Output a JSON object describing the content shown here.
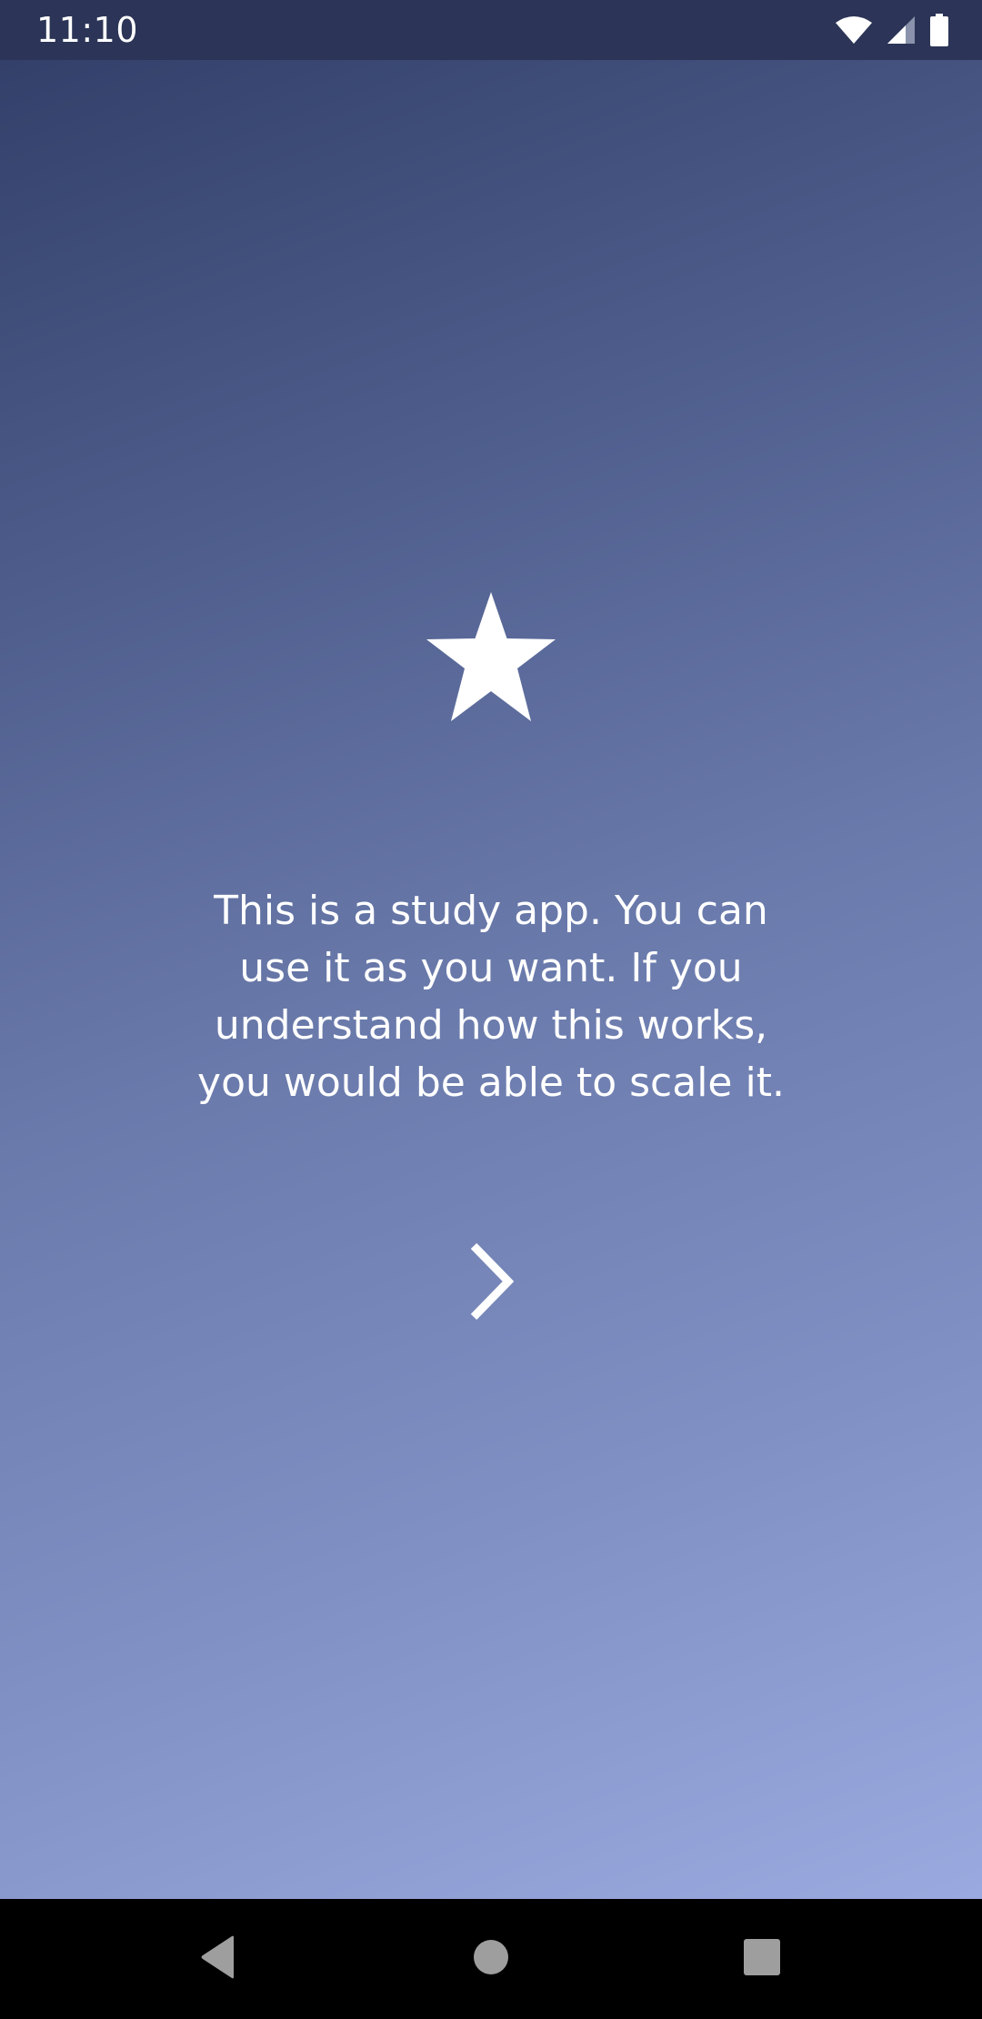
{
  "status_bar": {
    "time": "11:10",
    "icons": [
      "wifi-icon",
      "signal-icon",
      "battery-icon"
    ]
  },
  "main": {
    "icon": "star-icon",
    "description": "This is a study app. You can use it as you want. If you understand how this works, you would be able to scale it.",
    "next_icon": "chevron-right-icon"
  },
  "nav_bar": {
    "buttons": [
      "back-icon",
      "home-icon",
      "recents-icon"
    ]
  },
  "colors": {
    "status_bar_bg": "#2c3557",
    "gradient_top": "#33406a",
    "gradient_bottom": "#9aaae0",
    "nav_bar_bg": "#000000",
    "foreground": "#ffffff",
    "nav_icon": "#9e9e9e"
  }
}
